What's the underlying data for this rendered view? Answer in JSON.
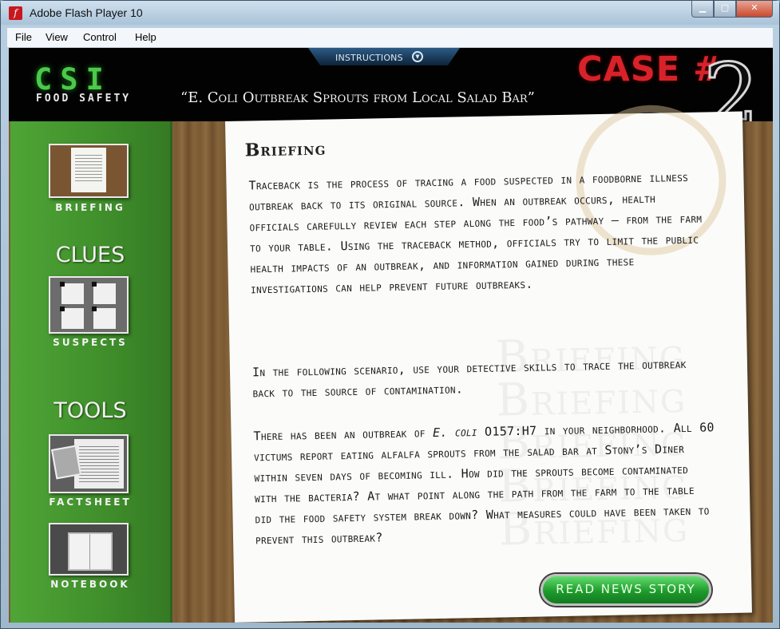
{
  "window": {
    "title": "Adobe Flash Player 10"
  },
  "menu": {
    "items": [
      "File",
      "View",
      "Control",
      "Help"
    ]
  },
  "header": {
    "instructions_label": "INSTRUCTIONS",
    "logo": "CSI",
    "logo_sub": "FOOD SAFETY",
    "case_title": "“E. Coli Outbreak Sprouts from Local Salad Bar”",
    "case_label": "CASE #",
    "case_number": "2"
  },
  "sidebar": {
    "briefing_label": "BRIEFING",
    "clues_heading": "CLUES",
    "suspects_label": "SUSPECTS",
    "tools_heading": "TOOLS",
    "factsheet_label": "FACTSHEET",
    "notebook_label": "NOTEBOOK"
  },
  "briefing": {
    "title": "Briefing",
    "paragraph1": "Traceback is the process of tracing a food suspected in a foodborne illness outbreak back to its original source. When an outbreak occurs, health officials carefully review each step along the food’s pathway – from the farm to your table. Using the traceback method, officials try to limit the public health impacts of an outbreak, and  information gained during these investigations can help prevent future outbreaks.",
    "paragraph2": "In the following scenario, use your detective skills to trace the outbreak back to the source of contamination.",
    "paragraph3_pre": "There has been an outbreak of ",
    "paragraph3_italic": "E. coli",
    "paragraph3_post": " O157:H7 in your neighborhood. All 60 victums report eating alfalfa sprouts from the salad bar at Stony’s Diner within seven days of becoming ill. How did the sprouts become contaminated with the bacteria? At what point along the path from the farm to the table did the food safety system break down? What measures could have been taken to prevent this outbreak?",
    "watermark": "Briefing",
    "news_button": "READ NEWS STORY"
  },
  "icons": [
    "flash-icon",
    "minimize-icon",
    "maximize-icon",
    "close-icon",
    "chevron-down-icon"
  ]
}
